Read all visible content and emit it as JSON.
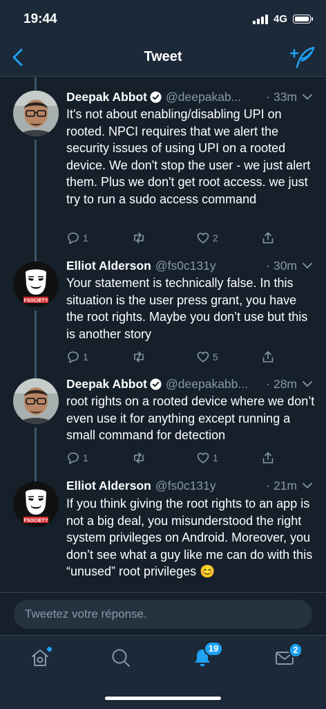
{
  "status_bar": {
    "time": "19:44",
    "network": "4G"
  },
  "nav": {
    "title": "Tweet"
  },
  "tweets": [
    {
      "author": "Deepak Abbot",
      "verified": true,
      "handle": "@deepakab...",
      "time": "· 33m",
      "text": "It's not about enabling/disabling UPI on rooted. NPCI requires that we alert the security issues of using UPI on a rooted device. We don't stop the user - we just alert them. Plus we don't get root access. we just try to run a sudo access command",
      "replies": "1",
      "retweets": "",
      "likes": "2"
    },
    {
      "author": "Elliot Alderson",
      "verified": false,
      "handle": "@fs0c131y",
      "time": "· 30m",
      "text": "Your statement is technically false. In this situation is the user press grant, you have the root rights. Maybe you don’t use but this is another story",
      "replies": "1",
      "retweets": "",
      "likes": "5"
    },
    {
      "author": "Deepak Abbot",
      "verified": true,
      "handle": "@deepakabb...",
      "time": "· 28m",
      "text": "root rights on a rooted device where we don’t even use it for anything except running a small command for detection",
      "replies": "1",
      "retweets": "",
      "likes": "1"
    },
    {
      "author": "Elliot Alderson",
      "verified": false,
      "handle": "@fs0c131y",
      "time": "· 21m",
      "text": "If you think giving the root rights to an app is not a big deal, you misunderstood the right system privileges on Android. Moreover, you don’t see what a guy like me can do with this “unused” root privileges 😊",
      "replies": "",
      "retweets": "",
      "likes": ""
    }
  ],
  "fsociety_label": "FSOCIETY",
  "reply": {
    "placeholder": "Tweetez votre réponse."
  },
  "tabs": {
    "notifications_badge": "19",
    "messages_badge": "2"
  },
  "colors": {
    "background": "#15202b",
    "bar": "#1c2938",
    "accent": "#1da1f2",
    "muted": "#8899a6",
    "thread_line": "#3d5466"
  }
}
